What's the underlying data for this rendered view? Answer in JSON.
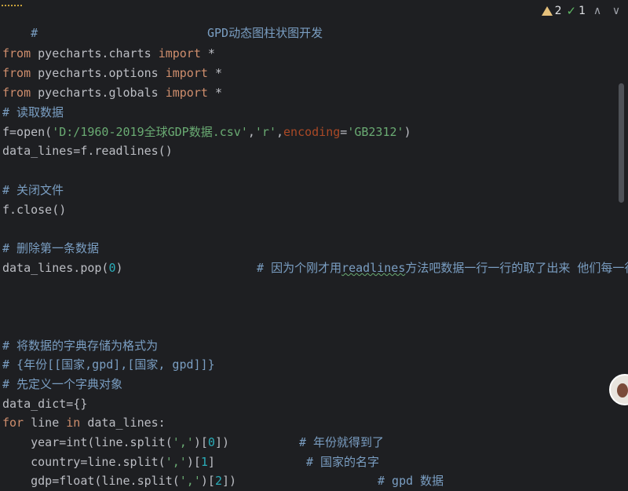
{
  "editor": {
    "title_comment": {
      "hash": "#",
      "title": "GPD动态图柱状图开发"
    },
    "imports": [
      {
        "kw1": "from",
        "mod": "pyecharts.charts",
        "kw2": "import",
        "star": "*"
      },
      {
        "kw1": "from",
        "mod": "pyecharts.options",
        "kw2": "import",
        "star": "*"
      },
      {
        "kw1": "from",
        "mod": "pyecharts.globals",
        "kw2": "import",
        "star": "*"
      }
    ],
    "c_read": "# 读取数据",
    "open_line": {
      "pre": "f=open(",
      "path": "'D:/1960-2019全球GDP数据.csv'",
      "comma1": ",",
      "mode": "'r'",
      "comma2": ",",
      "enc_key": "encoding",
      "eq": "=",
      "enc_val": "'GB2312'",
      "close": ")"
    },
    "readlines_line": "data_lines=f.readlines()",
    "c_close": "# 关闭文件",
    "close_line": "f.close()",
    "c_delete": "# 删除第一条数据",
    "pop_line": {
      "pre": "data_lines.pop(",
      "num": "0",
      "post": ")",
      "c_hash": "#",
      "c_a": "因为个刚才用",
      "c_b": "readlines",
      "c_c": "方法吧数据一行一行的取了出来 他们每一行都"
    },
    "c_store": "# 将数据的字典存储为格式为",
    "c_format": "# {年份[[国家,gpd],[国家, gpd]]}",
    "c_define": "# 先定义一个字典对象",
    "dict_line": "data_dict={}",
    "for_line": {
      "kw_for": "for",
      "var": " line ",
      "kw_in": "in",
      "rest": " data_lines:"
    },
    "year_line": {
      "pre": "    year=int(line.split(",
      "str": "','",
      "mid": ")[",
      "num": "0",
      "post": "])",
      "comment": "# 年份就得到了"
    },
    "country_line": {
      "pre": "    country=line.split(",
      "str": "','",
      "mid": ")[",
      "num": "1",
      "post": "]",
      "comment": "# 国家的名字"
    },
    "gdp_line": {
      "pre": "    gdp=float(line.split(",
      "str": "','",
      "mid": ")[",
      "num": "2",
      "post": "])",
      "comment": "# gpd 数据"
    }
  },
  "inspections": {
    "warnings": "2",
    "weak_warnings": "1",
    "prev_icon": "chevron-up-icon",
    "next_icon": "chevron-down-icon",
    "prev_glyph": "∧",
    "next_glyph": "∨"
  },
  "colors": {
    "background": "#1e1f22",
    "keyword": "#cf8e6d",
    "comment": "#7a9ec2",
    "string": "#6aab73",
    "number": "#2aacb8",
    "named_arg": "#aa4926"
  }
}
